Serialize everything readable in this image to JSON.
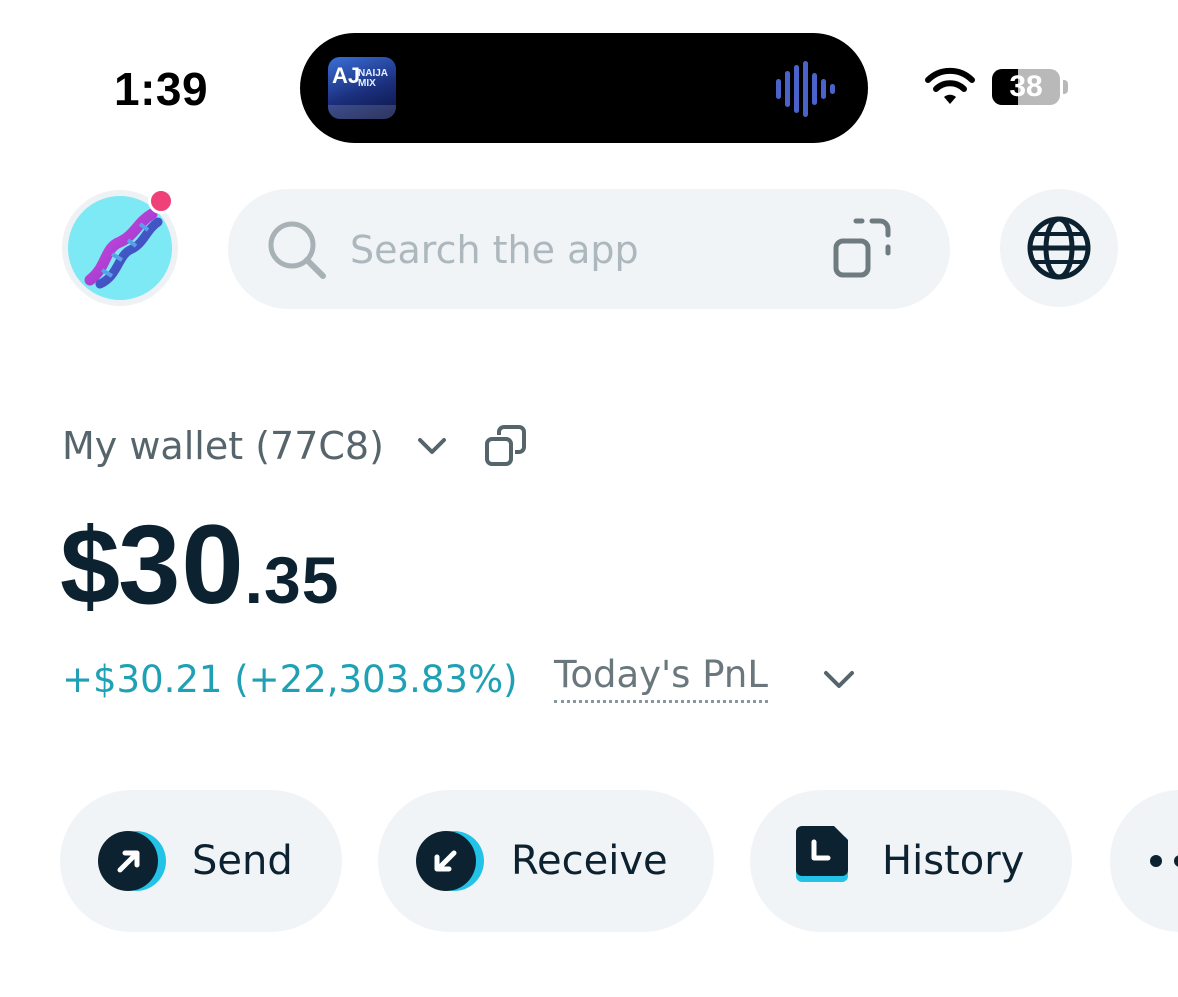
{
  "status_bar": {
    "time": "1:39",
    "now_playing_art_text": "AJ",
    "now_playing_art_sub": "NAIJA MIX",
    "battery_percent": "38",
    "battery_level": 0.38
  },
  "header": {
    "avatar_icon": "dna-icon",
    "notification_dot_color": "#f0407a",
    "search": {
      "placeholder": "Search the app",
      "value": ""
    },
    "scan_icon": "scan-icon",
    "globe_icon": "globe-icon"
  },
  "wallet": {
    "name": "My wallet (77C8)",
    "balance_currency": "$",
    "balance_integer": "30",
    "balance_decimal": ".35",
    "pnl_value": "+$30.21 (+22,303.83%)",
    "pnl_label": "Today's PnL",
    "pnl_color": "#1fa0b4"
  },
  "actions": {
    "send": "Send",
    "receive": "Receive",
    "history": "History",
    "accent_color": "#22c3e6"
  }
}
